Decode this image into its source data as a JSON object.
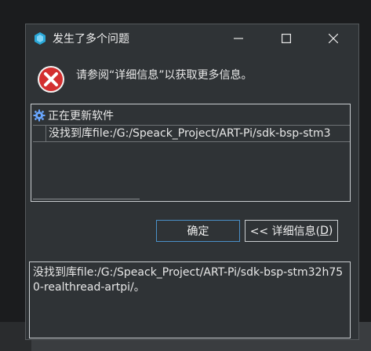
{
  "dialog": {
    "title": "发生了多个问题",
    "message": "请参阅“详细信息”以获取更多信息。",
    "window_buttons": {
      "minimize_icon": "minimize-icon",
      "maximize_icon": "maximize-icon",
      "close_icon": "close-icon"
    },
    "error_icon": "error-icon",
    "tree": {
      "root_label": "正在更新软件",
      "root_icon": "gear-icon",
      "child_label": "没找到库file:/G:/Speack_Project/ART-Pi/sdk-bsp-stm3"
    },
    "buttons": {
      "ok_label": "确定",
      "details_prefix": "<< 详细信息(",
      "details_mnemonic": "D",
      "details_suffix": ")"
    },
    "details_text": "没找到库file:/G:/Speack_Project/ART-Pi/sdk-bsp-stm32h750-realthread-artpi/。"
  },
  "colors": {
    "dialog_bg": "#2f3336",
    "ok_border": "#4a90c8",
    "error_red": "#d32f2f",
    "gear_blue": "#6aa7ff"
  }
}
